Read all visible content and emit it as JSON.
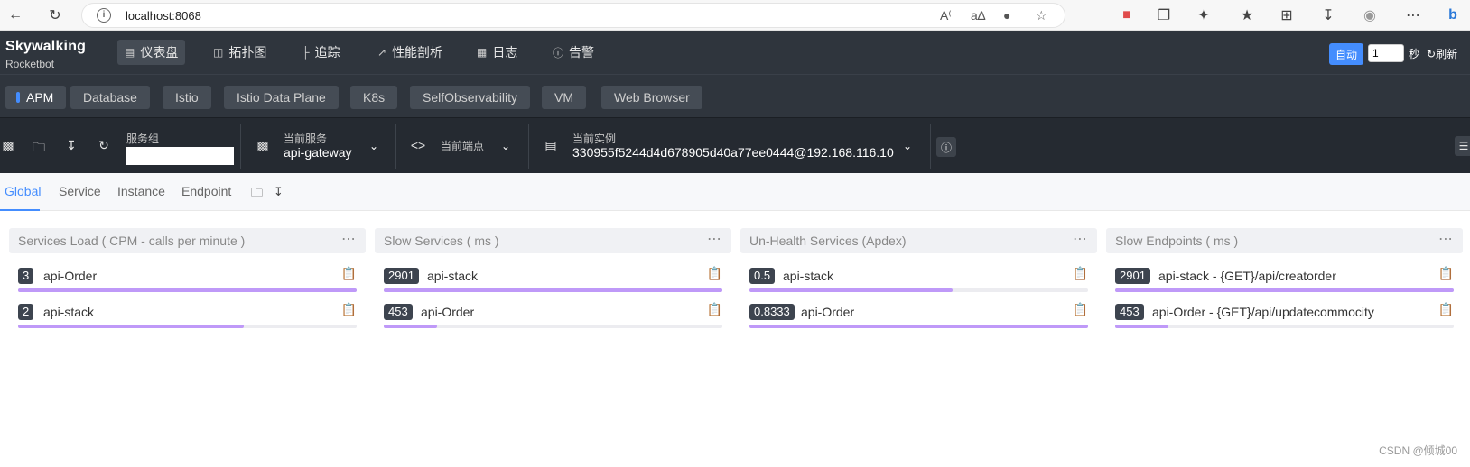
{
  "browser": {
    "url": "localhost:8068",
    "back_icon": "back-arrow-icon",
    "reload_icon": "reload-icon"
  },
  "header": {
    "logo_main": "Skywalking",
    "logo_sub": "Rocketbot",
    "nav": [
      {
        "label": "仪表盘",
        "icon": "dashboard-icon",
        "active": true
      },
      {
        "label": "拓扑图",
        "icon": "topology-icon",
        "active": false
      },
      {
        "label": "追踪",
        "icon": "trace-icon",
        "active": false
      },
      {
        "label": "性能剖析",
        "icon": "profile-icon",
        "active": false
      },
      {
        "label": "日志",
        "icon": "log-icon",
        "active": false
      },
      {
        "label": "告警",
        "icon": "alarm-icon",
        "active": false
      }
    ],
    "auto_label": "自动",
    "interval_value": "1",
    "seconds_label": "秒",
    "refresh_label": "刷新"
  },
  "layers": [
    "APM",
    "Database",
    "Istio",
    "Istio Data Plane",
    "K8s",
    "SelfObservability",
    "VM",
    "Web Browser"
  ],
  "selectors": {
    "group_label": "服务组",
    "group_value": "",
    "service_label": "当前服务",
    "service_value": "api-gateway",
    "endpoint_label": "当前端点",
    "instance_label": "当前实例",
    "instance_value": "330955f5244d4d678905d40a77ee0444@192.168.116.10"
  },
  "tabs": [
    "Global",
    "Service",
    "Instance",
    "Endpoint"
  ],
  "widgets": [
    {
      "title": "Services Load ( CPM - calls per minute )",
      "rows": [
        {
          "value": "3",
          "name": "api-Order",
          "pct": 100
        },
        {
          "value": "2",
          "name": "api-stack",
          "pct": 66.7
        }
      ]
    },
    {
      "title": "Slow Services ( ms )",
      "rows": [
        {
          "value": "2901",
          "name": "api-stack",
          "pct": 100
        },
        {
          "value": "453",
          "name": "api-Order",
          "pct": 15.6
        }
      ]
    },
    {
      "title": "Un-Health Services (Apdex)",
      "rows": [
        {
          "value": "0.5",
          "name": "api-stack",
          "pct": 60
        },
        {
          "value": "0.8333",
          "name": "api-Order",
          "pct": 100
        }
      ]
    },
    {
      "title": "Slow Endpoints ( ms )",
      "rows": [
        {
          "value": "2901",
          "name": "api-stack - {GET}/api/creatorder",
          "pct": 100
        },
        {
          "value": "453",
          "name": "api-Order - {GET}/api/updatecommocity",
          "pct": 15.6
        }
      ]
    }
  ],
  "watermark": "CSDN @倾城00",
  "colors": {
    "accent": "#448dfe",
    "bar": "#bf99f8",
    "header_bg": "#2f353d"
  }
}
